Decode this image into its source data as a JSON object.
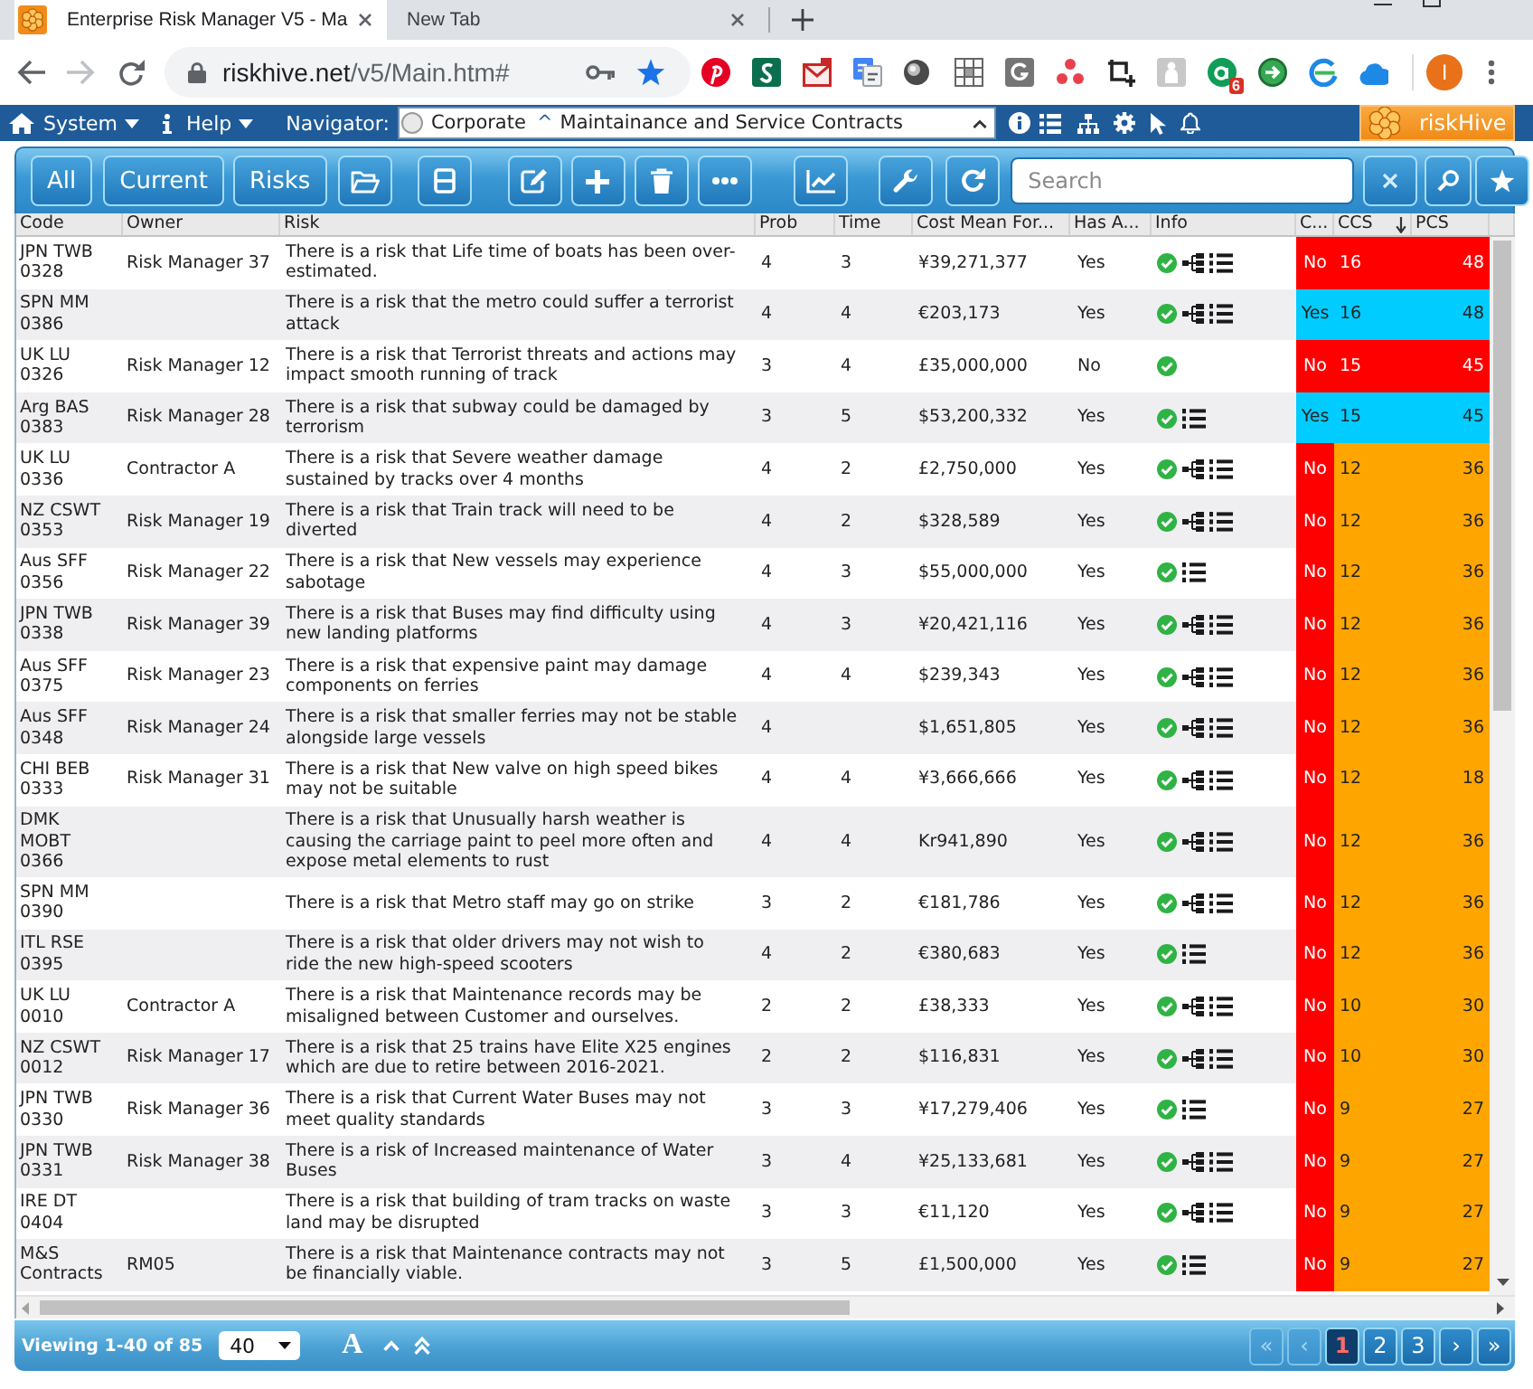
{
  "browser": {
    "tabs": [
      {
        "kind": "site",
        "title": "Enterprise Risk Manager V5 - Ma",
        "selected": true
      },
      {
        "kind": "blank",
        "title": "New Tab",
        "selected": false
      }
    ],
    "address": {
      "host": "riskhive.net",
      "path": "/v5/Main.htm#"
    },
    "extension_badge": "6",
    "profile_initial": "I"
  },
  "menu_bar": {
    "menus": [
      {
        "label": "System"
      },
      {
        "label": "Help"
      }
    ],
    "navigator_label": "Navigator:",
    "navigator": {
      "root": "Corporate",
      "separator": "^",
      "current": "Maintainance and Service Contracts"
    },
    "brand": "riskHive"
  },
  "toolbar": {
    "view_buttons": [
      "All",
      "Current",
      "Risks"
    ],
    "search": {
      "placeholder": "Search"
    }
  },
  "grid": {
    "columns": [
      {
        "label": "Code",
        "sorted": false
      },
      {
        "label": "Owner",
        "sorted": false
      },
      {
        "label": "Risk",
        "sorted": false
      },
      {
        "label": "Prob",
        "sorted": false
      },
      {
        "label": "Time",
        "sorted": false
      },
      {
        "label": "Cost Mean For...",
        "sorted": false
      },
      {
        "label": "Has A...",
        "sorted": false
      },
      {
        "label": "Info",
        "sorted": false
      },
      {
        "label": "C...",
        "sorted": false
      },
      {
        "label": "CCS",
        "sorted": true
      },
      {
        "label": "PCS",
        "sorted": false
      }
    ],
    "rows": [
      {
        "code": "JPN TWB 0328",
        "owner": "Risk Manager 37",
        "risk": "There is a risk that Life time of boats has been over-estimated.",
        "prob": "4",
        "time": "3",
        "cost_mean": "¥39,271,377",
        "has_a": "Yes",
        "info": {
          "check": true,
          "tree": true,
          "list": true
        },
        "c": {
          "text": "No",
          "color": "#ff0000"
        },
        "ccs": {
          "text": "16",
          "color": "#ff0000"
        },
        "pcs": {
          "text": "48",
          "color": "#ff0000"
        }
      },
      {
        "code": "SPN MM 0386",
        "risk": "There is a risk that the metro could suffer a terrorist attack",
        "prob": "4",
        "time": "4",
        "cost_mean": "€203,173",
        "has_a": "Yes",
        "info": {
          "check": true,
          "tree": true,
          "list": true
        },
        "c": {
          "text": "Yes",
          "color": "#00ccff"
        },
        "ccs": {
          "text": "16",
          "color": "#00ccff"
        },
        "pcs": {
          "text": "48",
          "color": "#00ccff"
        }
      },
      {
        "code": "UK LU 0326",
        "owner": "Risk Manager 12",
        "risk": "There is a risk that Terrorist threats and actions may impact smooth running of track",
        "prob": "3",
        "time": "4",
        "cost_mean": "£35,000,000",
        "has_a": "No",
        "info": {
          "check": true,
          "tree": false,
          "list": false
        },
        "c": {
          "text": "No",
          "color": "#ff0000"
        },
        "ccs": {
          "text": "15",
          "color": "#ff0000"
        },
        "pcs": {
          "text": "45",
          "color": "#ff0000"
        }
      },
      {
        "code": "Arg BAS 0383",
        "owner": "Risk Manager 28",
        "risk": "There is a risk that subway could be damaged by terrorism",
        "prob": "3",
        "time": "5",
        "cost_mean": "$53,200,332",
        "has_a": "Yes",
        "info": {
          "check": true,
          "tree": false,
          "list": true
        },
        "c": {
          "text": "Yes",
          "color": "#00ccff"
        },
        "ccs": {
          "text": "15",
          "color": "#00ccff"
        },
        "pcs": {
          "text": "45",
          "color": "#00ccff"
        }
      },
      {
        "code": "UK LU 0336",
        "owner": "Contractor A",
        "risk": "There is a risk that Severe weather damage sustained by tracks over 4 months",
        "prob": "4",
        "time": "2",
        "cost_mean": "£2,750,000",
        "has_a": "Yes",
        "info": {
          "check": true,
          "tree": true,
          "list": true
        },
        "c": {
          "text": "No",
          "color": "#ff0000"
        },
        "ccs": {
          "text": "12",
          "color": "#ffa500"
        },
        "pcs": {
          "text": "36",
          "color": "#ffa500"
        }
      },
      {
        "code": "NZ CSWT 0353",
        "owner": "Risk Manager 19",
        "risk": "There is a risk that Train track will need to be diverted",
        "prob": "4",
        "time": "2",
        "cost_mean": "$328,589",
        "has_a": "Yes",
        "info": {
          "check": true,
          "tree": true,
          "list": true
        },
        "c": {
          "text": "No",
          "color": "#ff0000"
        },
        "ccs": {
          "text": "12",
          "color": "#ffa500"
        },
        "pcs": {
          "text": "36",
          "color": "#ffa500"
        }
      },
      {
        "code": "Aus SFF 0356",
        "owner": "Risk Manager 22",
        "risk": "There is a risk that New vessels may experience sabotage",
        "prob": "4",
        "time": "3",
        "cost_mean": "$55,000,000",
        "has_a": "Yes",
        "info": {
          "check": true,
          "tree": false,
          "list": true
        },
        "c": {
          "text": "No",
          "color": "#ff0000"
        },
        "ccs": {
          "text": "12",
          "color": "#ffa500"
        },
        "pcs": {
          "text": "36",
          "color": "#ffa500"
        }
      },
      {
        "code": "JPN TWB 0338",
        "owner": "Risk Manager 39",
        "risk": "There is a risk that Buses may find difficulty using new landing platforms",
        "prob": "4",
        "time": "3",
        "cost_mean": "¥20,421,116",
        "has_a": "Yes",
        "info": {
          "check": true,
          "tree": true,
          "list": true
        },
        "c": {
          "text": "No",
          "color": "#ff0000"
        },
        "ccs": {
          "text": "12",
          "color": "#ffa500"
        },
        "pcs": {
          "text": "36",
          "color": "#ffa500"
        }
      },
      {
        "code": "Aus SFF 0375",
        "owner": "Risk Manager 23",
        "risk": "There is a risk that expensive paint may damage components on ferries",
        "prob": "4",
        "time": "4",
        "cost_mean": "$239,343",
        "has_a": "Yes",
        "info": {
          "check": true,
          "tree": true,
          "list": true
        },
        "c": {
          "text": "No",
          "color": "#ff0000"
        },
        "ccs": {
          "text": "12",
          "color": "#ffa500"
        },
        "pcs": {
          "text": "36",
          "color": "#ffa500"
        }
      },
      {
        "code": "Aus SFF 0348",
        "owner": "Risk Manager 24",
        "risk": "There is a risk that smaller ferries may not be stable alongside large vessels",
        "prob": "4",
        "cost_mean": "$1,651,805",
        "has_a": "Yes",
        "info": {
          "check": true,
          "tree": true,
          "list": true
        },
        "c": {
          "text": "No",
          "color": "#ff0000"
        },
        "ccs": {
          "text": "12",
          "color": "#ffa500"
        },
        "pcs": {
          "text": "36",
          "color": "#ffa500"
        }
      },
      {
        "code": "CHI BEB 0333",
        "owner": "Risk Manager 31",
        "risk": "There is a risk that New valve on high speed bikes may not be suitable",
        "prob": "4",
        "time": "4",
        "cost_mean": "¥3,666,666",
        "has_a": "Yes",
        "info": {
          "check": true,
          "tree": true,
          "list": true
        },
        "c": {
          "text": "No",
          "color": "#ff0000"
        },
        "ccs": {
          "text": "12",
          "color": "#ffa500"
        },
        "pcs": {
          "text": "18",
          "color": "#ffa500"
        }
      },
      {
        "code": "DMK MOBT 0366",
        "risk": "There is a risk that Unusually harsh weather is causing the carriage paint to peel more often and expose metal elements to rust",
        "prob": "4",
        "time": "4",
        "cost_mean": "Kr941,890",
        "has_a": "Yes",
        "info": {
          "check": true,
          "tree": true,
          "list": true
        },
        "c": {
          "text": "No",
          "color": "#ff0000"
        },
        "ccs": {
          "text": "12",
          "color": "#ffa500"
        },
        "pcs": {
          "text": "36",
          "color": "#ffa500"
        }
      },
      {
        "code": "SPN MM 0390",
        "risk": "There is a risk that Metro staff may go on strike",
        "prob": "3",
        "time": "2",
        "cost_mean": "€181,786",
        "has_a": "Yes",
        "info": {
          "check": true,
          "tree": true,
          "list": true
        },
        "c": {
          "text": "No",
          "color": "#ff0000"
        },
        "ccs": {
          "text": "12",
          "color": "#ffa500"
        },
        "pcs": {
          "text": "36",
          "color": "#ffa500"
        }
      },
      {
        "code": "ITL RSE 0395",
        "risk": "There is a risk that older drivers may not wish to ride the new high-speed scooters",
        "prob": "4",
        "time": "2",
        "cost_mean": "€380,683",
        "has_a": "Yes",
        "info": {
          "check": true,
          "tree": false,
          "list": true
        },
        "c": {
          "text": "No",
          "color": "#ff0000"
        },
        "ccs": {
          "text": "12",
          "color": "#ffa500"
        },
        "pcs": {
          "text": "36",
          "color": "#ffa500"
        }
      },
      {
        "code": "UK LU 0010",
        "owner": "Contractor A",
        "risk": "There is a risk that Maintenance records may be misaligned between Customer and ourselves.",
        "prob": "2",
        "time": "2",
        "cost_mean": "£38,333",
        "has_a": "Yes",
        "info": {
          "check": true,
          "tree": true,
          "list": true
        },
        "c": {
          "text": "No",
          "color": "#ff0000"
        },
        "ccs": {
          "text": "10",
          "color": "#ffa500"
        },
        "pcs": {
          "text": "30",
          "color": "#ffa500"
        }
      },
      {
        "code": "NZ CSWT 0012",
        "owner": "Risk Manager 17",
        "risk": "There is a risk that 25 trains have Elite X25 engines which are due to retire between 2016-2021.",
        "prob": "2",
        "time": "2",
        "cost_mean": "$116,831",
        "has_a": "Yes",
        "info": {
          "check": true,
          "tree": true,
          "list": true
        },
        "c": {
          "text": "No",
          "color": "#ff0000"
        },
        "ccs": {
          "text": "10",
          "color": "#ffa500"
        },
        "pcs": {
          "text": "30",
          "color": "#ffa500"
        }
      },
      {
        "code": "JPN TWB 0330",
        "owner": "Risk Manager 36",
        "risk": "There is a risk that Current Water Buses may not meet quality standards",
        "prob": "3",
        "time": "3",
        "cost_mean": "¥17,279,406",
        "has_a": "Yes",
        "info": {
          "check": true,
          "tree": false,
          "list": true
        },
        "c": {
          "text": "No",
          "color": "#ff0000"
        },
        "ccs": {
          "text": "9",
          "color": "#ffa500"
        },
        "pcs": {
          "text": "27",
          "color": "#ffa500"
        }
      },
      {
        "code": "JPN TWB 0331",
        "owner": "Risk Manager 38",
        "risk": "There is a risk of Increased maintenance of Water Buses",
        "prob": "3",
        "time": "4",
        "cost_mean": "¥25,133,681",
        "has_a": "Yes",
        "info": {
          "check": true,
          "tree": true,
          "list": true
        },
        "c": {
          "text": "No",
          "color": "#ff0000"
        },
        "ccs": {
          "text": "9",
          "color": "#ffa500"
        },
        "pcs": {
          "text": "27",
          "color": "#ffa500"
        }
      },
      {
        "code": "IRE DT 0404",
        "risk": "There is a risk that building of tram tracks on waste land may be disrupted",
        "prob": "3",
        "time": "3",
        "cost_mean": "€11,120",
        "has_a": "Yes",
        "info": {
          "check": true,
          "tree": true,
          "list": true
        },
        "c": {
          "text": "No",
          "color": "#ff0000"
        },
        "ccs": {
          "text": "9",
          "color": "#ffa500"
        },
        "pcs": {
          "text": "27",
          "color": "#ffa500"
        }
      },
      {
        "code": "M&S Contracts",
        "owner": "RM05",
        "risk": "There is a risk that Maintenance contracts may not be financially viable.",
        "prob": "3",
        "time": "5",
        "cost_mean": "£1,500,000",
        "has_a": "Yes",
        "info": {
          "check": true,
          "tree": false,
          "list": true
        },
        "c": {
          "text": "No",
          "color": "#ff0000"
        },
        "ccs": {
          "text": "9",
          "color": "#ffa500"
        },
        "pcs": {
          "text": "27",
          "color": "#ffa500"
        }
      }
    ]
  },
  "footer": {
    "summary": "Viewing 1-40 of 85",
    "page_size": "40",
    "font_button": "A",
    "pages": [
      {
        "label": "«",
        "selected": false,
        "disabled": true
      },
      {
        "label": "‹",
        "selected": false,
        "disabled": true
      },
      {
        "label": "1",
        "selected": true,
        "disabled": false
      },
      {
        "label": "2",
        "selected": false,
        "disabled": false
      },
      {
        "label": "3",
        "selected": false,
        "disabled": false
      },
      {
        "label": "›",
        "selected": false,
        "disabled": false
      },
      {
        "label": "»",
        "selected": false,
        "disabled": false
      }
    ]
  }
}
